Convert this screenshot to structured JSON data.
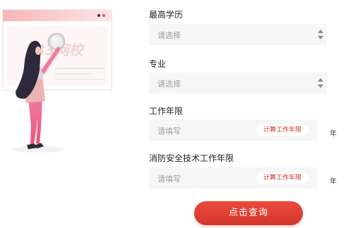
{
  "education": {
    "label": "最高学历",
    "placeholder": "请选择"
  },
  "major": {
    "label": "专业",
    "placeholder": "请选择"
  },
  "work_years": {
    "label": "工作年限",
    "placeholder": "请填写",
    "calc_label": "计算工作年限",
    "unit": "年"
  },
  "fire_work_years": {
    "label": "消防安全技术工作年限",
    "placeholder": "请填写",
    "calc_label": "计算工作年限",
    "unit": "年"
  },
  "submit_label": "点击查询",
  "watermark": "233网校",
  "colors": {
    "accent": "#d5362b",
    "field_bg": "#f6f6f6",
    "placeholder": "#9a9a9a"
  },
  "icons": [
    "select-arrows-icon",
    "magnifier-icon"
  ]
}
